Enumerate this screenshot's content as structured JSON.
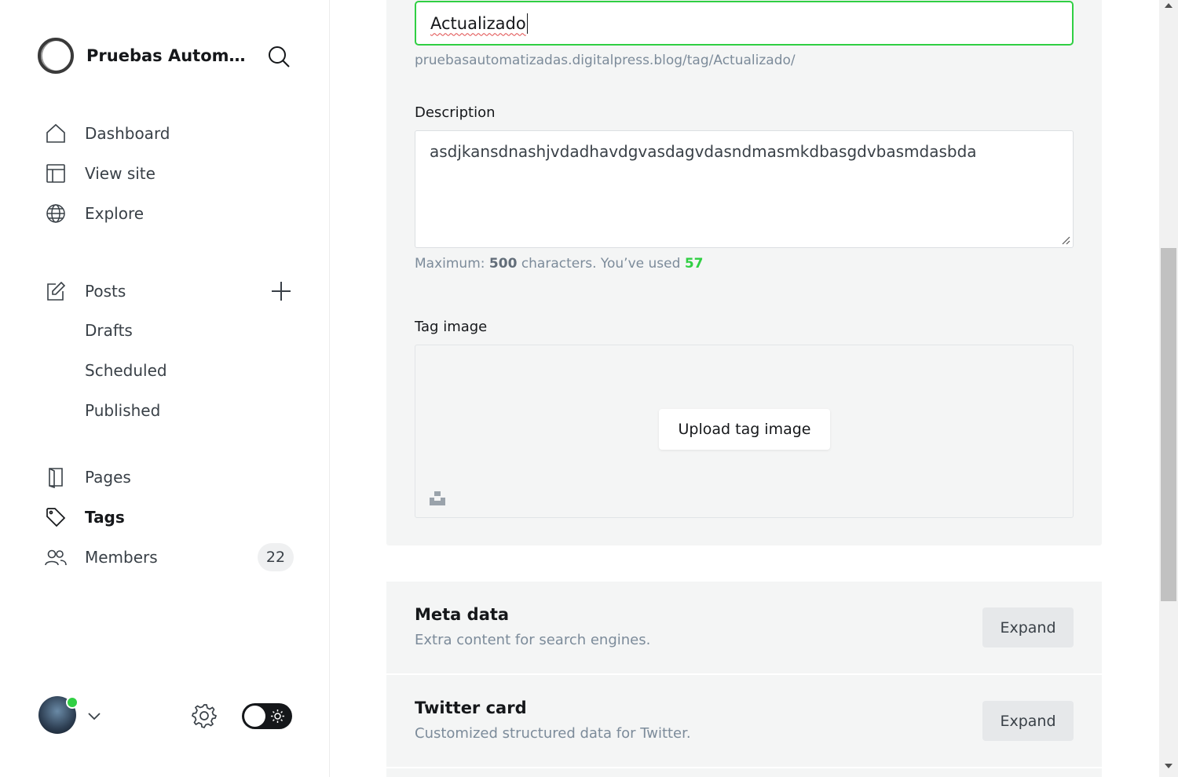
{
  "sidebar": {
    "site_title": "Pruebas Automatizadas",
    "nav": [
      {
        "label": "Dashboard",
        "icon": "home-icon"
      },
      {
        "label": "View site",
        "icon": "layout-icon"
      },
      {
        "label": "Explore",
        "icon": "globe-icon"
      }
    ],
    "posts": {
      "label": "Posts",
      "icon": "pencil-square-icon",
      "sub_items": [
        "Drafts",
        "Scheduled",
        "Published"
      ]
    },
    "pages_label": "Pages",
    "tags_label": "Tags",
    "members_label": "Members",
    "members_count": "22",
    "online_status_color": "#30cf43"
  },
  "tag_form": {
    "name_value": "Actualizado",
    "slug_url": "pruebasautomatizadas.digitalpress.blog/tag/Actualizado/",
    "description_label": "Description",
    "description_value": "asdjkansdnashjvdadhavdgvasdagvdasndmasmkdbasgdvbasmdasbda",
    "hint_prefix": "Maximum:",
    "hint_max": "500",
    "hint_middle": "characters. You’ve used",
    "hint_used": "57",
    "tag_image_label": "Tag image",
    "upload_label": "Upload tag image"
  },
  "sections": [
    {
      "title": "Meta data",
      "subtitle": "Extra content for search engines.",
      "button": "Expand"
    },
    {
      "title": "Twitter card",
      "subtitle": "Customized structured data for Twitter.",
      "button": "Expand"
    }
  ],
  "colors": {
    "accent_green": "#30cf43",
    "text_dark": "#15171a",
    "text_muted": "#7c8b9a",
    "card_bg": "#f4f5f5"
  }
}
